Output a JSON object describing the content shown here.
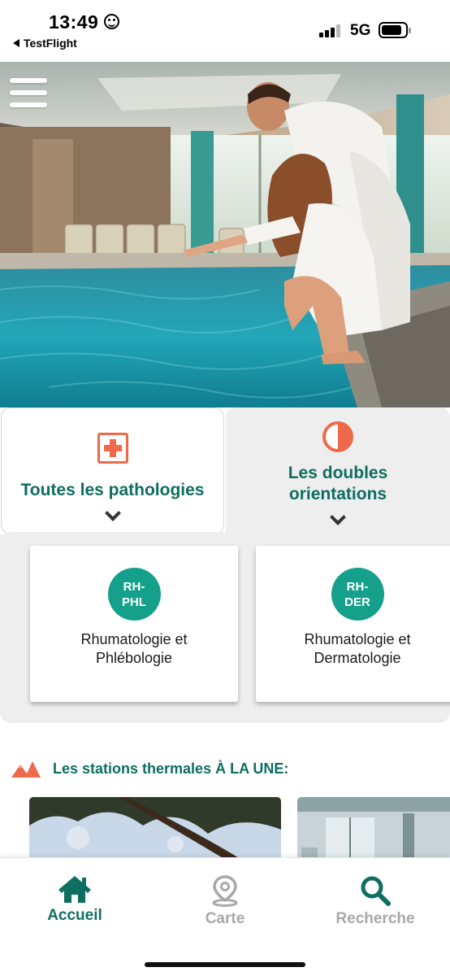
{
  "status_bar": {
    "time": "13:49",
    "back_label": "TestFlight",
    "network": "5G",
    "icons": [
      "smiley-icon",
      "signal-icon",
      "battery-icon"
    ]
  },
  "hero": {
    "menu_icon": "hamburger-menu-icon",
    "image_subject": "couple in bathrobes by indoor thermal pool"
  },
  "tabs": [
    {
      "label": "Toutes les pathologies",
      "icon": "medical-cross-icon",
      "active": true
    },
    {
      "label": "Les doubles orientations",
      "icon": "half-circle-icon",
      "active": false
    }
  ],
  "orientations": [
    {
      "badge": "RH-\nPHL",
      "label": "Rhumatologie et\nPhlébologie"
    },
    {
      "badge": "RH-\nDER",
      "label": "Rhumatologie et\nDermatologie"
    }
  ],
  "featured": {
    "title": "Les stations thermales À LA UNE:",
    "icon": "mountains-icon"
  },
  "bottom_nav": [
    {
      "label": "Accueil",
      "icon": "home-icon",
      "active": true
    },
    {
      "label": "Carte",
      "icon": "map-pin-icon",
      "active": false
    },
    {
      "label": "Recherche",
      "icon": "search-icon",
      "active": false
    }
  ],
  "colors": {
    "brand_green": "#0e6e5f",
    "badge_teal": "#14a08b",
    "accent_orange": "#ef6a4b",
    "inactive_gray": "#a9a9a9",
    "panel_gray": "#eeeeee"
  }
}
